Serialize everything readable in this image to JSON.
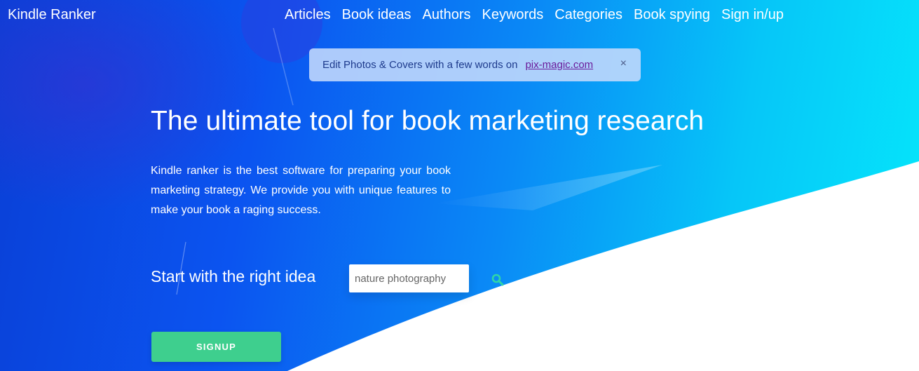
{
  "brand": {
    "name": "Kindle Ranker"
  },
  "nav": {
    "items": [
      {
        "label": "Articles"
      },
      {
        "label": "Book ideas"
      },
      {
        "label": "Authors"
      },
      {
        "label": "Keywords"
      },
      {
        "label": "Categories"
      },
      {
        "label": "Book spying"
      },
      {
        "label": "Sign in/up"
      }
    ]
  },
  "banner": {
    "text": "Edit Photos & Covers with a few words on",
    "link": "pix-magic.com",
    "close": "×"
  },
  "hero": {
    "title": "The ultimate tool for book marketing research",
    "description": "Kindle ranker is the best software for preparing your book marketing strategy. We provide you with unique features to make your book a raging success.",
    "start_label": "Start with the right idea",
    "search_placeholder": "nature photography",
    "search_icon": "search-icon",
    "signup_label": "SIGNUP"
  },
  "colors": {
    "gradient_start": "#0a3fd6",
    "gradient_end": "#05e8fb",
    "signup": "#3ecf8e",
    "search_icon": "#2fd6a8"
  }
}
